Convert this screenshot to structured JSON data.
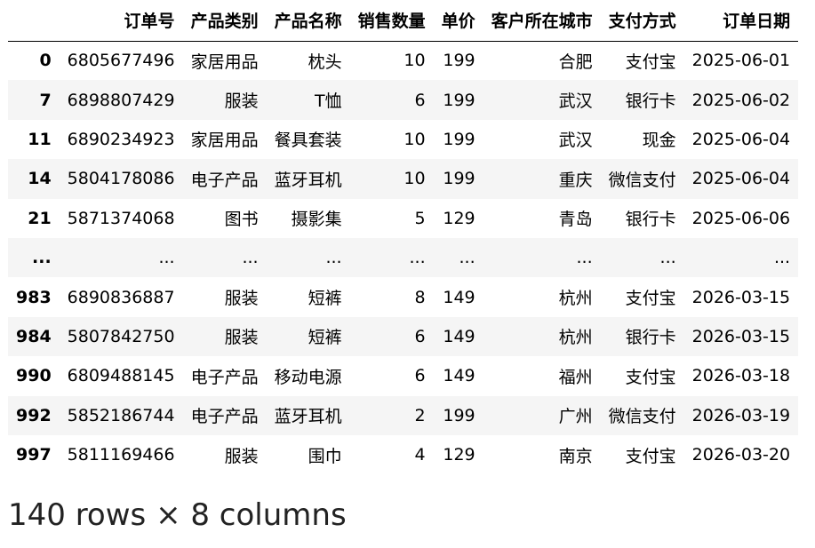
{
  "table": {
    "columns": [
      "",
      "订单号",
      "产品类别",
      "产品名称",
      "销售数量",
      "单价",
      "客户所在城市",
      "支付方式",
      "订单日期"
    ],
    "rows": [
      [
        "0",
        "6805677496",
        "家居用品",
        "枕头",
        "10",
        "199",
        "合肥",
        "支付宝",
        "2025-06-01"
      ],
      [
        "7",
        "6898807429",
        "服装",
        "T恤",
        "6",
        "199",
        "武汉",
        "银行卡",
        "2025-06-02"
      ],
      [
        "11",
        "6890234923",
        "家居用品",
        "餐具套装",
        "10",
        "199",
        "武汉",
        "现金",
        "2025-06-04"
      ],
      [
        "14",
        "5804178086",
        "电子产品",
        "蓝牙耳机",
        "10",
        "199",
        "重庆",
        "微信支付",
        "2025-06-04"
      ],
      [
        "21",
        "5871374068",
        "图书",
        "摄影集",
        "5",
        "129",
        "青岛",
        "银行卡",
        "2025-06-06"
      ],
      [
        "...",
        "...",
        "...",
        "...",
        "...",
        "...",
        "...",
        "...",
        "..."
      ],
      [
        "983",
        "6890836887",
        "服装",
        "短裤",
        "8",
        "149",
        "杭州",
        "支付宝",
        "2026-03-15"
      ],
      [
        "984",
        "5807842750",
        "服装",
        "短裤",
        "6",
        "149",
        "杭州",
        "银行卡",
        "2026-03-15"
      ],
      [
        "990",
        "6809488145",
        "电子产品",
        "移动电源",
        "6",
        "149",
        "福州",
        "支付宝",
        "2026-03-18"
      ],
      [
        "992",
        "5852186744",
        "电子产品",
        "蓝牙耳机",
        "2",
        "199",
        "广州",
        "微信支付",
        "2026-03-19"
      ],
      [
        "997",
        "5811169466",
        "服装",
        "围巾",
        "4",
        "129",
        "南京",
        "支付宝",
        "2026-03-20"
      ]
    ]
  },
  "shape_text": "140 rows × 8 columns"
}
